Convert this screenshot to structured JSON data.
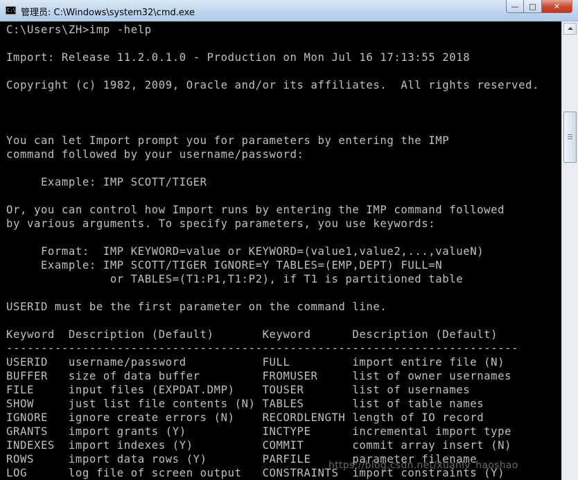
{
  "window": {
    "title": "管理员: C:\\Windows\\system32\\cmd.exe",
    "icon_label": "C:\\",
    "buttons": {
      "minimize": "—",
      "maximize": "□",
      "close": "✕"
    }
  },
  "console": {
    "lines": [
      "C:\\Users\\ZH>imp -help",
      "",
      "Import: Release 11.2.0.1.0 - Production on Mon Jul 16 17:13:55 2018",
      "",
      "Copyright (c) 1982, 2009, Oracle and/or its affiliates.  All rights reserved.",
      "",
      "",
      "",
      "You can let Import prompt you for parameters by entering the IMP",
      "command followed by your username/password:",
      "",
      "     Example: IMP SCOTT/TIGER",
      "",
      "Or, you can control how Import runs by entering the IMP command followed",
      "by various arguments. To specify parameters, you use keywords:",
      "",
      "     Format:  IMP KEYWORD=value or KEYWORD=(value1,value2,...,valueN)",
      "     Example: IMP SCOTT/TIGER IGNORE=Y TABLES=(EMP,DEPT) FULL=N",
      "               or TABLES=(T1:P1,T1:P2), if T1 is partitioned table",
      "",
      "USERID must be the first parameter on the command line.",
      "",
      "Keyword  Description (Default)       Keyword      Description (Default)",
      "--------------------------------------------------------------------------",
      "USERID   username/password           FULL         import entire file (N)",
      "BUFFER   size of data buffer         FROMUSER     list of owner usernames",
      "FILE     input files (EXPDAT.DMP)    TOUSER       list of usernames",
      "SHOW     just list file contents (N) TABLES       list of table names",
      "IGNORE   ignore create errors (N)    RECORDLENGTH length of IO record",
      "GRANTS   import grants (Y)           INCTYPE      incremental import type",
      "INDEXES  import indexes (Y)          COMMIT       commit array insert (N)",
      "ROWS     import data rows (Y)        PARFILE      parameter filename",
      "LOG      log file of screen output   CONSTRAINTS  import constraints (Y)"
    ]
  },
  "watermark": "https://blog.csdn.net/xuanlv_haoshao"
}
